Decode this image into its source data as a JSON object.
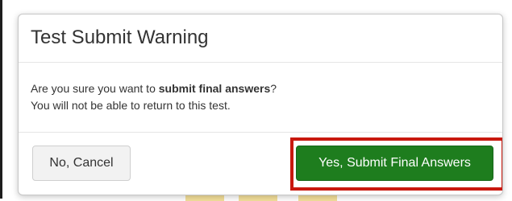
{
  "dialog": {
    "title": "Test Submit Warning",
    "message": {
      "line1_prefix": "Are you sure you want to ",
      "line1_bold": "submit final answers",
      "line1_suffix": "?",
      "line2": "You will not be able to return to this test."
    },
    "buttons": {
      "cancel_label": "No, Cancel",
      "submit_label": "Yes, Submit Final Answers"
    }
  },
  "colors": {
    "submit_button": "#1e7d1e",
    "highlight_outline": "#c8180e",
    "cancel_button": "#f2f2f2",
    "title_text": "#333333"
  }
}
